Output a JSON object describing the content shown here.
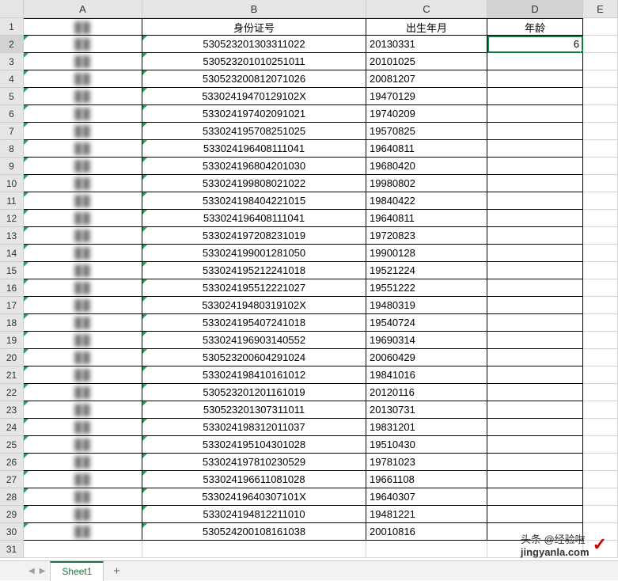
{
  "columns": [
    "A",
    "B",
    "C",
    "D",
    "E"
  ],
  "active_col_index": 3,
  "active_row_index": 1,
  "col_widths": {
    "A": 150,
    "B": 283,
    "C": 153,
    "D": 121,
    "E": 44
  },
  "rows_shown": 31,
  "headers": {
    "A": "姓名",
    "B": "身份证号",
    "C": "出生年月",
    "D": "年龄"
  },
  "active_cell": {
    "col": "D",
    "row": 2
  },
  "tab_name": "Sheet1",
  "watermark": {
    "line1": "头条 @经验啦",
    "line2": "jingyanla.com"
  },
  "data": [
    {
      "B": "530523201303311022",
      "C": "20130331",
      "D": "6"
    },
    {
      "B": "530523201010251011",
      "C": "20101025",
      "D": ""
    },
    {
      "B": "530523200812071026",
      "C": "20081207",
      "D": ""
    },
    {
      "B": "53302419470129102X",
      "C": "19470129",
      "D": ""
    },
    {
      "B": "533024197402091021",
      "C": "19740209",
      "D": ""
    },
    {
      "B": "533024195708251025",
      "C": "19570825",
      "D": ""
    },
    {
      "B": "533024196408111041",
      "C": "19640811",
      "D": ""
    },
    {
      "B": "533024196804201030",
      "C": "19680420",
      "D": ""
    },
    {
      "B": "533024199808021022",
      "C": "19980802",
      "D": ""
    },
    {
      "B": "533024198404221015",
      "C": "19840422",
      "D": ""
    },
    {
      "B": "533024196408111041",
      "C": "19640811",
      "D": ""
    },
    {
      "B": "533024197208231019",
      "C": "19720823",
      "D": ""
    },
    {
      "B": "533024199001281050",
      "C": "19900128",
      "D": ""
    },
    {
      "B": "533024195212241018",
      "C": "19521224",
      "D": ""
    },
    {
      "B": "533024195512221027",
      "C": "19551222",
      "D": ""
    },
    {
      "B": "53302419480319102X",
      "C": "19480319",
      "D": ""
    },
    {
      "B": "533024195407241018",
      "C": "19540724",
      "D": ""
    },
    {
      "B": "533024196903140552",
      "C": "19690314",
      "D": ""
    },
    {
      "B": "530523200604291024",
      "C": "20060429",
      "D": ""
    },
    {
      "B": "533024198410161012",
      "C": "19841016",
      "D": ""
    },
    {
      "B": "530523201201161019",
      "C": "20120116",
      "D": ""
    },
    {
      "B": "530523201307311011",
      "C": "20130731",
      "D": ""
    },
    {
      "B": "533024198312011037",
      "C": "19831201",
      "D": ""
    },
    {
      "B": "533024195104301028",
      "C": "19510430",
      "D": ""
    },
    {
      "B": "533024197810230529",
      "C": "19781023",
      "D": ""
    },
    {
      "B": "533024196611081028",
      "C": "19661108",
      "D": ""
    },
    {
      "B": "53302419640307101X",
      "C": "19640307",
      "D": ""
    },
    {
      "B": "533024194812211010",
      "C": "19481221",
      "D": ""
    },
    {
      "B": "530524200108161038",
      "C": "20010816",
      "D": ""
    }
  ]
}
